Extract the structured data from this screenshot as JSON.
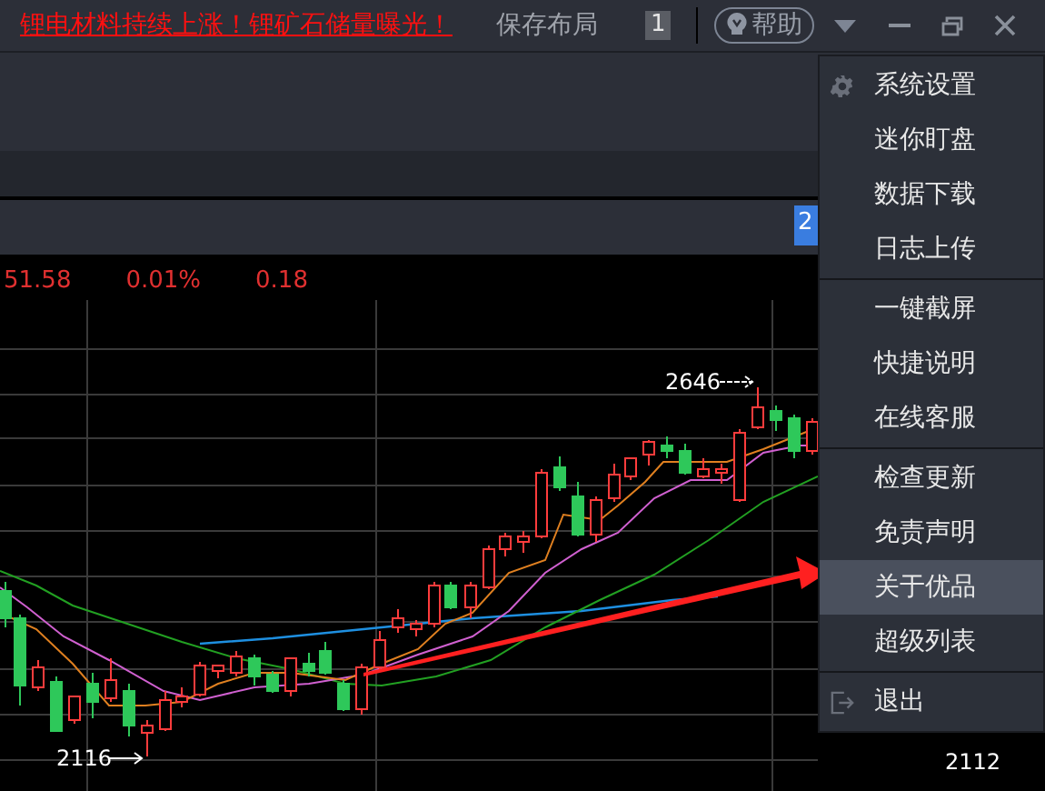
{
  "top_bar": {
    "news_link": "锂电材料持续上涨！锂矿石储量曝光！",
    "save_layout": "保存布局",
    "layout_number": "1",
    "help": "帮助"
  },
  "tab_badge": "2",
  "quote_row": [
    "51.58",
    "0.01%",
    "0.18"
  ],
  "chart": {
    "high_label": "2646",
    "low_label": "2116",
    "axis_label": "2112"
  },
  "menu": {
    "groups": [
      [
        {
          "label": "系统设置",
          "kind": "settings",
          "selected": false
        },
        {
          "label": "迷你盯盘",
          "kind": "plain",
          "selected": false
        },
        {
          "label": "数据下载",
          "kind": "plain",
          "selected": false
        },
        {
          "label": "日志上传",
          "kind": "plain",
          "selected": false
        }
      ],
      [
        {
          "label": "一键截屏",
          "kind": "plain",
          "selected": false
        },
        {
          "label": "快捷说明",
          "kind": "plain",
          "selected": false
        },
        {
          "label": "在线客服",
          "kind": "plain",
          "selected": false
        }
      ],
      [
        {
          "label": "检查更新",
          "kind": "plain",
          "selected": false
        },
        {
          "label": "免责声明",
          "kind": "plain",
          "selected": false
        },
        {
          "label": "关于优品",
          "kind": "plain",
          "selected": true
        },
        {
          "label": "超级列表",
          "kind": "plain",
          "selected": false
        }
      ],
      [
        {
          "label": "退出",
          "kind": "exit",
          "selected": false
        }
      ]
    ]
  }
}
